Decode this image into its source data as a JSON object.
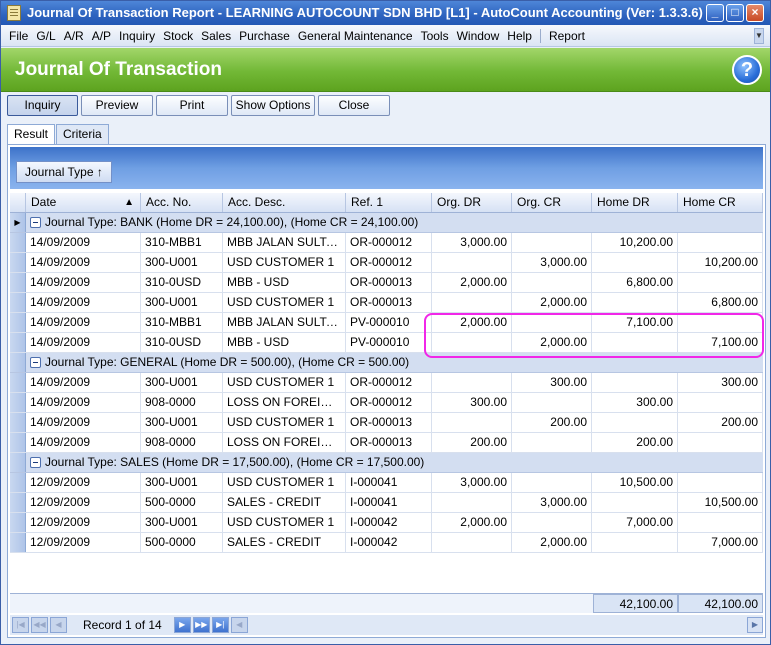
{
  "window": {
    "title": "Journal Of Transaction Report - LEARNING AUTOCOUNT SDN BHD [L1] - AutoCount Accounting (Ver: 1.3.3.6)",
    "controls": [
      "_",
      "□",
      "×"
    ]
  },
  "menu": {
    "items": [
      "File",
      "G/L",
      "A/R",
      "A/P",
      "Inquiry",
      "Stock",
      "Sales",
      "Purchase",
      "General Maintenance",
      "Tools",
      "Window",
      "Help",
      "Report"
    ]
  },
  "header": {
    "title": "Journal Of Transaction",
    "help_label": "?"
  },
  "toolbar": {
    "inquiry": "Inquiry",
    "preview": "Preview",
    "print": "Print",
    "show_options": "Show Options",
    "close": "Close"
  },
  "tabs": [
    "Result",
    "Criteria"
  ],
  "group_by": {
    "label": "Journal Type",
    "arrow": "↑"
  },
  "columns": [
    "Date",
    "Acc. No.",
    "Acc. Desc.",
    "Ref. 1",
    "Org. DR",
    "Org. CR",
    "Home DR",
    "Home CR"
  ],
  "groups": [
    {
      "label": "Journal Type: BANK (Home DR = 24,100.00), (Home CR = 24,100.00)",
      "rows": [
        [
          "14/09/2009",
          "310-MBB1",
          "MBB JALAN SULTAN",
          "OR-000012",
          "3,000.00",
          "",
          "10,200.00",
          ""
        ],
        [
          "14/09/2009",
          "300-U001",
          "USD CUSTOMER 1",
          "OR-000012",
          "",
          "3,000.00",
          "",
          "10,200.00"
        ],
        [
          "14/09/2009",
          "310-0USD",
          "MBB - USD",
          "OR-000013",
          "2,000.00",
          "",
          "6,800.00",
          ""
        ],
        [
          "14/09/2009",
          "300-U001",
          "USD CUSTOMER 1",
          "OR-000013",
          "",
          "2,000.00",
          "",
          "6,800.00"
        ],
        [
          "14/09/2009",
          "310-MBB1",
          "MBB JALAN SULTAN",
          "PV-000010",
          "2,000.00",
          "",
          "7,100.00",
          ""
        ],
        [
          "14/09/2009",
          "310-0USD",
          "MBB - USD",
          "PV-000010",
          "",
          "2,000.00",
          "",
          "7,100.00"
        ]
      ]
    },
    {
      "label": "Journal Type: GENERAL (Home DR = 500.00), (Home CR = 500.00)",
      "rows": [
        [
          "14/09/2009",
          "300-U001",
          "USD CUSTOMER 1",
          "OR-000012",
          "",
          "300.00",
          "",
          "300.00"
        ],
        [
          "14/09/2009",
          "908-0000",
          "LOSS ON FOREIGN E...",
          "OR-000012",
          "300.00",
          "",
          "300.00",
          ""
        ],
        [
          "14/09/2009",
          "300-U001",
          "USD CUSTOMER 1",
          "OR-000013",
          "",
          "200.00",
          "",
          "200.00"
        ],
        [
          "14/09/2009",
          "908-0000",
          "LOSS ON FOREIGN E...",
          "OR-000013",
          "200.00",
          "",
          "200.00",
          ""
        ]
      ]
    },
    {
      "label": "Journal Type: SALES (Home DR = 17,500.00), (Home CR = 17,500.00)",
      "rows": [
        [
          "12/09/2009",
          "300-U001",
          "USD CUSTOMER 1",
          "I-000041",
          "3,000.00",
          "",
          "10,500.00",
          ""
        ],
        [
          "12/09/2009",
          "500-0000",
          "SALES - CREDIT",
          "I-000041",
          "",
          "3,000.00",
          "",
          "10,500.00"
        ],
        [
          "12/09/2009",
          "300-U001",
          "USD CUSTOMER 1",
          "I-000042",
          "2,000.00",
          "",
          "7,000.00",
          ""
        ],
        [
          "12/09/2009",
          "500-0000",
          "SALES - CREDIT",
          "I-000042",
          "",
          "2,000.00",
          "",
          "7,000.00"
        ]
      ]
    }
  ],
  "totals": {
    "home_dr": "42,100.00",
    "home_cr": "42,100.00"
  },
  "navigator": {
    "record_text": "Record 1 of 14"
  },
  "colors": {
    "highlight": "#f127e8",
    "header_green": "#72b836",
    "title_blue": "#2d63bf"
  }
}
